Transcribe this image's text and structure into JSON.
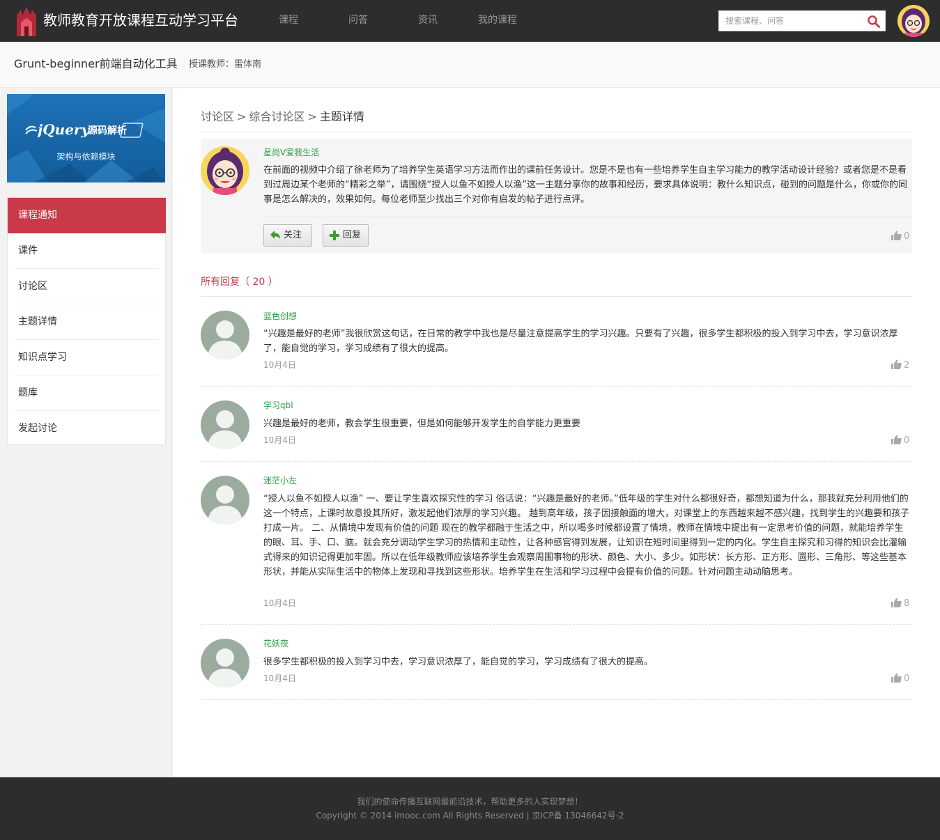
{
  "header": {
    "site_title": "教师教育开放课程互动学习平台",
    "nav": [
      "课程",
      "问答",
      "资讯",
      "我的课程"
    ],
    "search_placeholder": "搜索课程、问答"
  },
  "course": {
    "title": "Grunt-beginner前端自动化工具",
    "teacher": "授课教师：雷体南"
  },
  "sidebar": {
    "banner_logo": "jQuery",
    "banner_title": "源码解析",
    "banner_subtitle": "架构与依赖模块",
    "items": [
      {
        "label": "课程通知",
        "active": true
      },
      {
        "label": "课件"
      },
      {
        "label": "讨论区"
      },
      {
        "label": "主题详情"
      },
      {
        "label": "知识点学习"
      },
      {
        "label": "题库"
      },
      {
        "label": "发起讨论"
      }
    ]
  },
  "breadcrumb": {
    "items": [
      "讨论区",
      "综合讨论区",
      "主题详情"
    ],
    "separator": ">"
  },
  "topic": {
    "user": "星尚V爱我生活",
    "text": "在前面的视频中介绍了徐老师为了培养学生英语学习方法而作出的课前任务设计。您是不是也有一些培养学生自主学习能力的教学活动设计经验？或者您是不是看到过周边某个老师的“精彩之举”，请围绕“授人以鱼不如授人以渔”这一主题分享你的故事和经历，要求具体说明：教什么知识点，碰到的问题是什么，你或你的同事是怎么解决的，效果如何。每位老师至少找出三个对你有启发的帖子进行点评。",
    "follow_label": "关注",
    "reply_label": "回复",
    "likes": "0"
  },
  "replies_title": "所有回复（ 20 ）",
  "replies": [
    {
      "user": "蓝色创想",
      "text": "“兴趣是最好的老师”我很欣赏这句话，在日常的教学中我也是尽量注意提高学生的学习兴趣。只要有了兴趣，很多学生都积极的投入到学习中去，学习意识浓厚了，能自觉的学习，学习成绩有了很大的提高。",
      "date": "10月4日",
      "likes": "2"
    },
    {
      "user": "学习qbl",
      "text": "兴趣是最好的老师，教会学生很重要，但是如何能够开发学生的自学能力更重要",
      "date": "10月4日",
      "likes": "0"
    },
    {
      "user": "迷茫小左",
      "text": "“授人以鱼不如授人以渔” 一、要让学生喜欢探究性的学习 俗话说：“兴趣是最好的老师。”低年级的学生对什么都很好奇，都想知道为什么，那我就充分利用他们的这一个特点，上课时故意投其所好，激发起他们浓厚的学习兴趣。 越到高年级，孩子因接触面的增大，对课堂上的东西越来越不感兴趣，找到学生的兴趣要和孩子打成一片。 二、从情境中发现有价值的问题 现在的教学都融于生活之中，所以喝多时候都设置了情境，教师在情境中提出有一定思考价值的问题，就能培养学生的眼、耳、手、口、脑。就会充分调动学生学习的热情和主动性，让各种感官得到发展，让知识在短时间里得到一定的内化。学生自主探究和习得的知识会比灌输式得来的知识记得更加牢固。所以在低年级教师应该培养学生会观察周围事物的形状、颜色、大小、多少。如形状：长方形、正方形、圆形、三角形、等这些基本形状，并能从实际生活中的物体上发现和寻找到这些形状。培养学生在生活和学习过程中会提有价值的问题。针对问题主动动脑思考。",
      "date": "10月4日",
      "likes": "8"
    },
    {
      "user": "花妖夜",
      "text": "很多学生都积极的投入到学习中去，学习意识浓厚了，能自觉的学习，学习成绩有了很大的提高。",
      "date": "10月4日",
      "likes": "0"
    }
  ],
  "footer": {
    "line1": "我们的使命传播互联网最前沿技术，帮助更多的人实现梦想！",
    "line2": "Copyright © 2014 imooc.com All Rights Reserved | 京ICP备 13046642号-2"
  },
  "colors": {
    "topbar": "#2d2d2d",
    "accent": "#c9394a",
    "username": "#2e9f45",
    "banner": "#1d72b8"
  }
}
